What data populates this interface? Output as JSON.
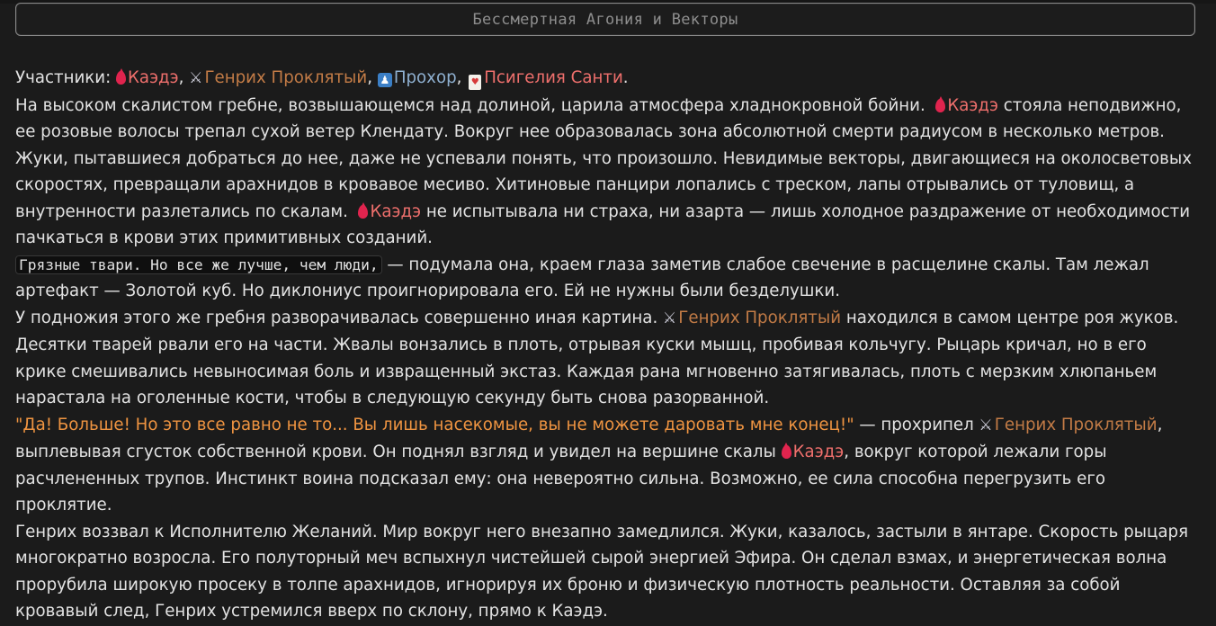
{
  "header": {
    "title": "Бессмертная Агония и Векторы"
  },
  "participants": {
    "label": "Участники:",
    "kaede": "Каэдэ",
    "henry": "Генрих Проклятый",
    "prokhor": "Прохор",
    "psigelia": "Псигелия Санти",
    "sep": ",",
    "end": "."
  },
  "paragraphs": {
    "p1": {
      "t1": "На высоком скалистом гребне, возвышающемся над долиной, царила атмосфера хладнокровной бойни.",
      "n1": "Каэдэ",
      "t2": "стояла неподвижно, ее розовые волосы трепал сухой ветер Клендату. Вокруг нее образовалась зона абсолютной смерти радиусом в несколько метров. Жуки, пытавшиеся добраться до нее, даже не успевали понять, что произошло. Невидимые векторы, двигающиеся на околосветовых скоростях, превращали арахнидов в кровавое месиво. Хитиновые панцири лопались с треском, лапы отрывались от туловищ, а внутренности разлетались по скалам.",
      "n2": "Каэдэ",
      "t3": "не испытывала ни страха, ни азарта — лишь холодное раздражение от необходимости пачкаться в крови этих примитивных созданий."
    },
    "p2": {
      "code": "Грязные твари. Но все же лучше, чем люди,",
      "t1": "— подумала она, краем глаза заметив слабое свечение в расщелине скалы. Там лежал артефакт — Золотой куб. Но диклониус проигнорировала его. Ей не нужны были безделушки."
    },
    "p3": {
      "t1": "У подножия этого же гребня разворачивалась совершенно иная картина.",
      "n1": "Генрих Проклятый",
      "t2": "находился в самом центре роя жуков. Десятки тварей рвали его на части. Жвалы вонзались в плоть, отрывая куски мышц, пробивая кольчугу. Рыцарь кричал, но в его крике смешивались невыносимая боль и извращенный экстаз. Каждая рана мгновенно затягивалась, плоть с мерзким хлюпаньем нарастала на оголенные кости, чтобы в следующую секунду быть снова разорванной."
    },
    "p4": {
      "quote": "\"Да! Больше! Но это все равно не то... Вы лишь насекомые, вы не можете даровать мне конец!\"",
      "t1": "— прохрипел",
      "n1": "Генрих Проклятый",
      "t2": ", выплевывая сгусток собственной крови. Он поднял взгляд и увидел на вершине скалы",
      "n2": "Каэдэ",
      "t3": ", вокруг которой лежали горы расчлененных трупов. Инстинкт воина подсказал ему: она невероятно сильна. Возможно, ее сила способна перегрузить его проклятие."
    },
    "p5": {
      "t1": "Генрих воззвал к Исполнителю Желаний. Мир вокруг него внезапно замедлился. Жуки, казалось, застыли в янтаре. Скорость рыцаря многократно возросла. Его полуторный меч вспыхнул чистейшей сырой энергией Эфира. Он сделал взмах, и энергетическая волна прорубила широкую просеку в толпе арахнидов, игнорируя их броню и физическую плотность реальности. Оставляя за собой кровавый след, Генрих устремился вверх по склону, прямо к Каэдэ."
    }
  },
  "icons": {
    "kaede": "drop-icon",
    "henry": "crossed-swords-icon",
    "prokhor": "person-icon",
    "psigelia": "playing-card-icon"
  },
  "colors": {
    "background": "#1b1b1b",
    "text": "#e2e2e2",
    "kaede": "#ee6f6c",
    "henry": "#c27b46",
    "prokhor": "#8fb0d0",
    "quote": "#ef9441"
  }
}
